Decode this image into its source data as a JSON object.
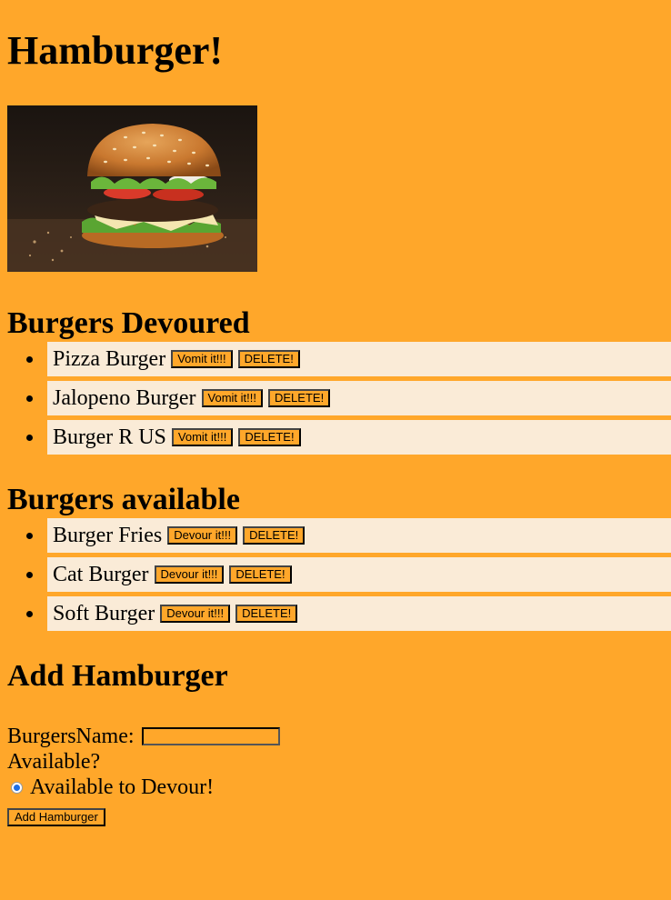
{
  "page": {
    "title": "Hamburger!"
  },
  "sections": {
    "devoured": {
      "heading": "Burgers Devoured",
      "items": [
        {
          "name": "Pizza Burger",
          "action_label": "Vomit it!!!",
          "delete_label": "DELETE!"
        },
        {
          "name": "Jalopeno Burger",
          "action_label": "Vomit it!!!",
          "delete_label": "DELETE!"
        },
        {
          "name": "Burger R US",
          "action_label": "Vomit it!!!",
          "delete_label": "DELETE!"
        }
      ]
    },
    "available": {
      "heading": "Burgers available",
      "items": [
        {
          "name": "Burger Fries",
          "action_label": "Devour it!!!",
          "delete_label": "DELETE!"
        },
        {
          "name": "Cat Burger",
          "action_label": "Devour it!!!",
          "delete_label": "DELETE!"
        },
        {
          "name": "Soft Burger",
          "action_label": "Devour it!!!",
          "delete_label": "DELETE!"
        }
      ]
    }
  },
  "form": {
    "heading": "Add Hamburger",
    "name_label": "BurgersName:",
    "name_value": "",
    "available_label": "Available?",
    "radio_label": "Available to Devour!",
    "radio_checked": true,
    "submit_label": "Add Hamburger"
  },
  "colors": {
    "background": "#ffa72a",
    "item_background": "#faebd7",
    "radio_accent": "#1e6fe6"
  }
}
